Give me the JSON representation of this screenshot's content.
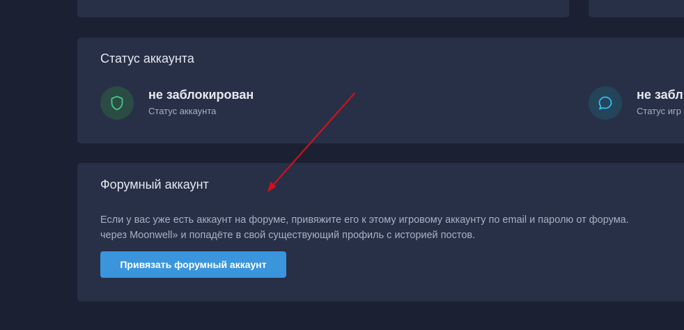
{
  "account_status": {
    "title": "Статус аккаунта",
    "items": [
      {
        "icon": "shield-icon",
        "value": "не заблокирован",
        "label": "Статус аккаунта",
        "accent": "#3fca8a"
      },
      {
        "icon": "chat-bubble-icon",
        "value": "не забл",
        "label": "Статус игр",
        "accent": "#34bff0"
      }
    ]
  },
  "forum_account": {
    "title": "Форумный аккаунт",
    "description_line1": "Если у вас уже есть аккаунт на форуме, привяжите его к этому игровому аккаунту по email и паролю от форума.",
    "description_line2": "через Moonwell» и попадёте в свой существующий профиль с историей постов.",
    "button_label": "Привязать форумный аккаунт"
  },
  "colors": {
    "page_background": "#1b2133",
    "card_background": "#283047",
    "button_background": "#3a95dd",
    "annotation_arrow": "#d0121b"
  }
}
